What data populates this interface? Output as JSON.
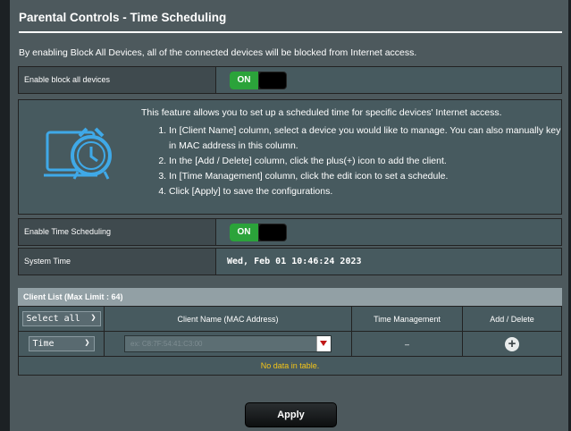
{
  "page": {
    "title": "Parental Controls - Time Scheduling",
    "description": "By enabling Block All Devices, all of the connected devices will be blocked from Internet access."
  },
  "block_all": {
    "label": "Enable block all devices",
    "toggle": "ON"
  },
  "info": {
    "intro": "This feature allows you to set up a scheduled time for specific devices' Internet access.",
    "steps": [
      "In [Client Name] column, select a device you would like to manage. You can also manually key in MAC address in this column.",
      "In the [Add / Delete] column, click the plus(+) icon to add the client.",
      "In [Time Management] column, click the edit icon to set a schedule.",
      "Click [Apply] to save the configurations."
    ],
    "icon": "alarm-clock-icon"
  },
  "time_scheduling": {
    "label": "Enable Time Scheduling",
    "toggle": "ON"
  },
  "system_time": {
    "label": "System Time",
    "value": "Wed, Feb 01 10:46:24 2023"
  },
  "client_list": {
    "header": "Client List (Max Limit : 64)",
    "select_all": "Select all",
    "columns": [
      "Client Name (MAC Address)",
      "Time Management",
      "Add / Delete"
    ],
    "time_select": "Time",
    "mac_placeholder": "ex: C8:7F:54:41:C3:00",
    "time_mgmt_value": "–",
    "empty_text": "No data in table."
  },
  "apply_label": "Apply",
  "colors": {
    "panel_bg": "#4d595d",
    "toggle_on": "#2ba33a",
    "empty_text": "#f5c518",
    "clock_blue": "#3fa9e8"
  }
}
